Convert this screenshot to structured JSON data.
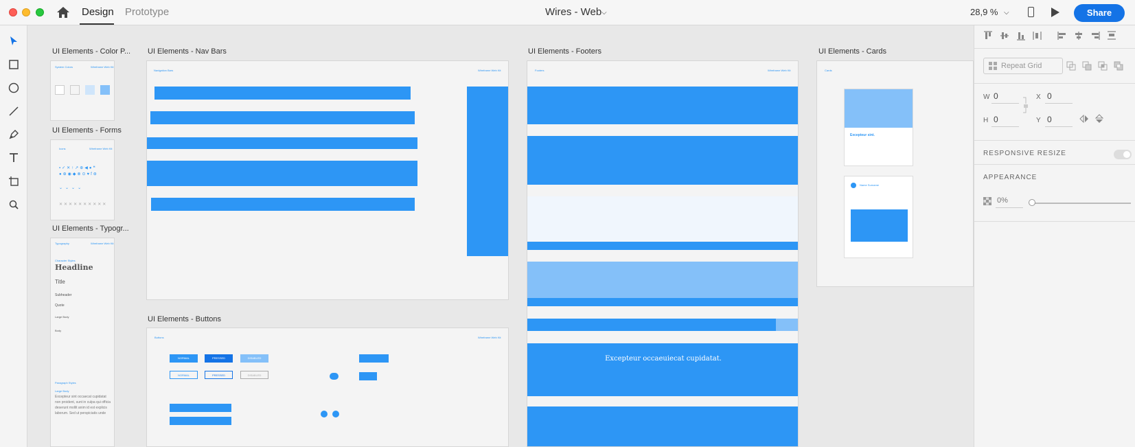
{
  "app": {
    "tabs": {
      "design": "Design",
      "prototype": "Prototype"
    },
    "document_title": "Wires - Web",
    "zoom": "28,9 %",
    "share_label": "Share"
  },
  "artboards": {
    "color_palette": {
      "label": "UI Elements - Color P...",
      "header": "System Colors",
      "brand": "Wireframe Web Kit"
    },
    "forms": {
      "label": "UI Elements - Forms",
      "header": "Icons",
      "brand": "Wireframe Web Kit"
    },
    "typography": {
      "label": "UI Elements - Typogr...",
      "header": "Typography",
      "brand": "Wireframe Web Kit",
      "character_styles": "Character Styles",
      "headline": "Headline",
      "title": "Title",
      "subheader": "Subheader",
      "quote": "Quote",
      "large_body": "Large Body",
      "body": "Body",
      "paragraph_styles": "Paragraph Styles",
      "large_body_p": "Large Body",
      "paragraph": "Excepteur sint occaecat cupidatat non proident, sunt in culpa qui officia deserunt mollit anim id est explicis laborum. Sed ut perspiciatis unde"
    },
    "nav_bars": {
      "label": "UI Elements - Nav Bars",
      "header": "Navigation Bars",
      "brand": "Wireframe Web Kit"
    },
    "buttons": {
      "label": "UI Elements - Buttons",
      "header": "Buttons",
      "brand": "Wireframe Web Kit",
      "normal": "NORMAL",
      "pressed": "PRESSED",
      "disabled": "DISABLED"
    },
    "footers": {
      "label": "UI Elements - Footers",
      "header": "Footers",
      "brand": "Wireframe Web Kit",
      "hero_title": "Excepteur occaeuiecat cupidatat."
    },
    "cards": {
      "label": "UI Elements - Cards",
      "header": "Cards",
      "card_title": "Excepteur sint.",
      "author": "Name Surname"
    }
  },
  "inspector": {
    "repeat_grid": "Repeat Grid",
    "w_label": "W",
    "w_value": "0",
    "x_label": "X",
    "x_value": "0",
    "h_label": "H",
    "h_value": "0",
    "y_label": "Y",
    "y_value": "0",
    "responsive_resize": "RESPONSIVE RESIZE",
    "appearance": "APPEARANCE",
    "opacity": "0%"
  },
  "colors": {
    "accent": "#2d96f5",
    "light_accent": "#84c0f9",
    "share": "#1473e6"
  }
}
